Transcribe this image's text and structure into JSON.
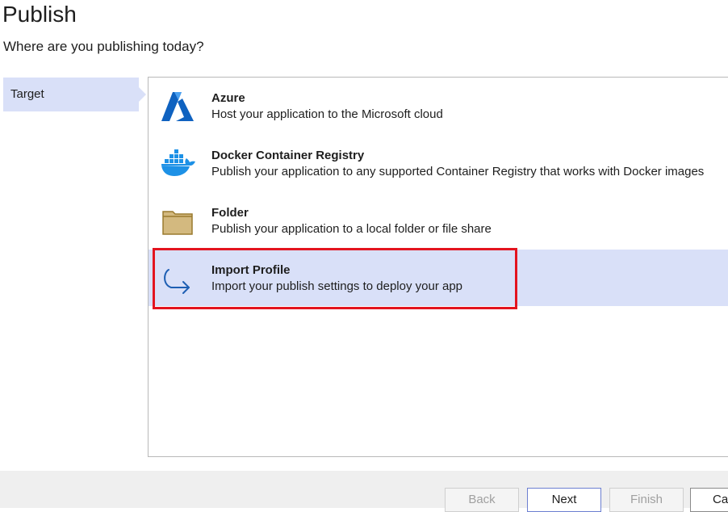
{
  "header": {
    "title": "Publish",
    "subtitle": "Where are you publishing today?"
  },
  "nav": {
    "items": [
      {
        "label": "Target",
        "selected": true
      }
    ]
  },
  "options": [
    {
      "title": "Azure",
      "description": "Host your application to the Microsoft cloud",
      "icon": "azure-icon"
    },
    {
      "title": "Docker Container Registry",
      "description": "Publish your application to any supported Container Registry that works with Docker images",
      "icon": "docker-icon"
    },
    {
      "title": "Folder",
      "description": "Publish your application to a local folder or file share",
      "icon": "folder-icon"
    },
    {
      "title": "Import Profile",
      "description": "Import your publish settings to deploy your app",
      "icon": "import-arrow-icon",
      "selected": true
    }
  ],
  "footer": {
    "back_label": "Back",
    "next_label": "Next",
    "finish_label": "Finish",
    "cancel_label": "Cancel"
  },
  "colors": {
    "selection": "#d9e0f8",
    "highlight": "#e3141f",
    "azure": "#0f62c0",
    "docker": "#1d91e6",
    "folder": "#d3b97f"
  }
}
